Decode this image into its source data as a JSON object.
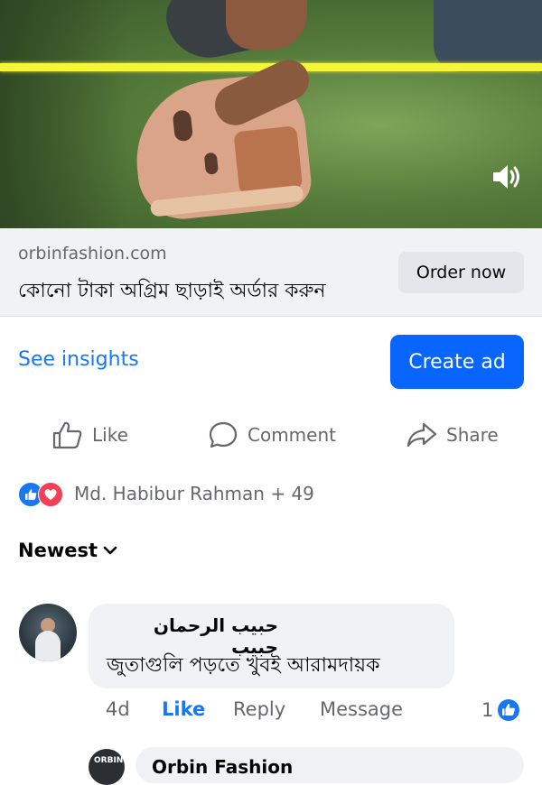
{
  "video": {
    "sound_icon": "speaker-icon"
  },
  "link_preview": {
    "domain": "orbinfashion.com",
    "headline": "কোনো টাকা অগ্রিম ছাড়াই অর্ডার করুন",
    "cta_label": "Order now"
  },
  "post_actions": {
    "insights_label": "See insights",
    "create_ad_label": "Create ad",
    "like_label": "Like",
    "comment_label": "Comment",
    "share_label": "Share"
  },
  "reactions": {
    "summary": "Md. Habibur Rahman + 49",
    "types": [
      "like",
      "love"
    ]
  },
  "comments": {
    "sort_label": "Newest",
    "items": [
      {
        "author": "حبیب الرحمان حبیب",
        "text": "জুতাগুলি পড়তে খুবই আরামদায়ক",
        "age": "4d",
        "like_label": "Like",
        "reply_label": "Reply",
        "message_label": "Message",
        "like_count": "1"
      }
    ],
    "reply_preview": {
      "author": "Orbin Fashion",
      "avatar_text": "ORBIN"
    }
  },
  "colors": {
    "accent": "#1877f2",
    "create_ad_bg": "#0866ff",
    "love": "#f33e58",
    "muted_text": "#65676b",
    "highlight_line": "#f5f53a"
  }
}
